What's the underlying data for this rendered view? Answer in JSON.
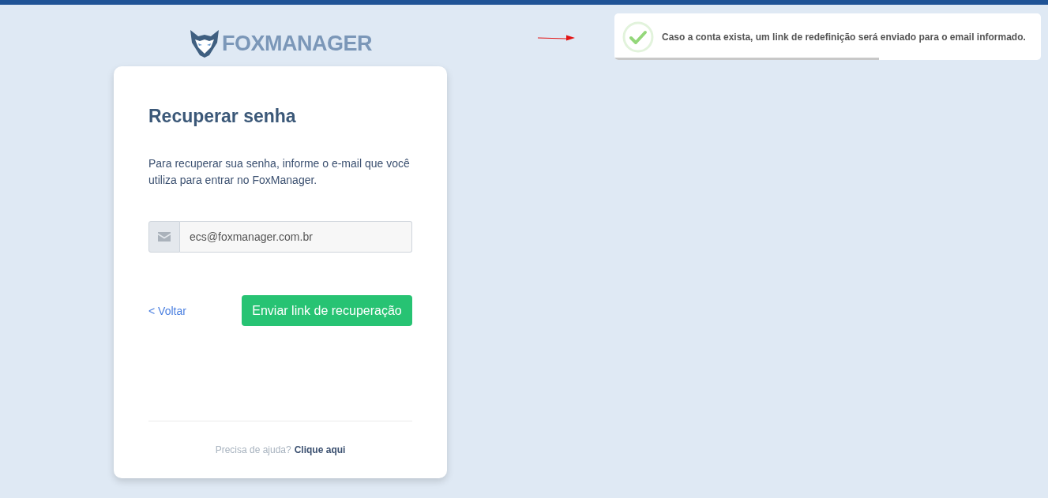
{
  "logo": {
    "text": "**FOX**MANAGER"
  },
  "card": {
    "title": "Recuperar senha",
    "description": "Para recuperar sua senha, informe o e-mail que você utiliza para entrar no FoxManager.",
    "email_field": {
      "value": "ecs@foxmanager.com.br"
    },
    "back_link": "< Voltar",
    "submit_button": "Enviar link de recuperação",
    "help": {
      "text": "Precisa de ajuda?",
      "link": "Clique aqui"
    }
  },
  "toast": {
    "kind": "success",
    "message": "Caso a conta exista, um link de redefinição será enviado para o email informado.",
    "level": 0.62
  }
}
